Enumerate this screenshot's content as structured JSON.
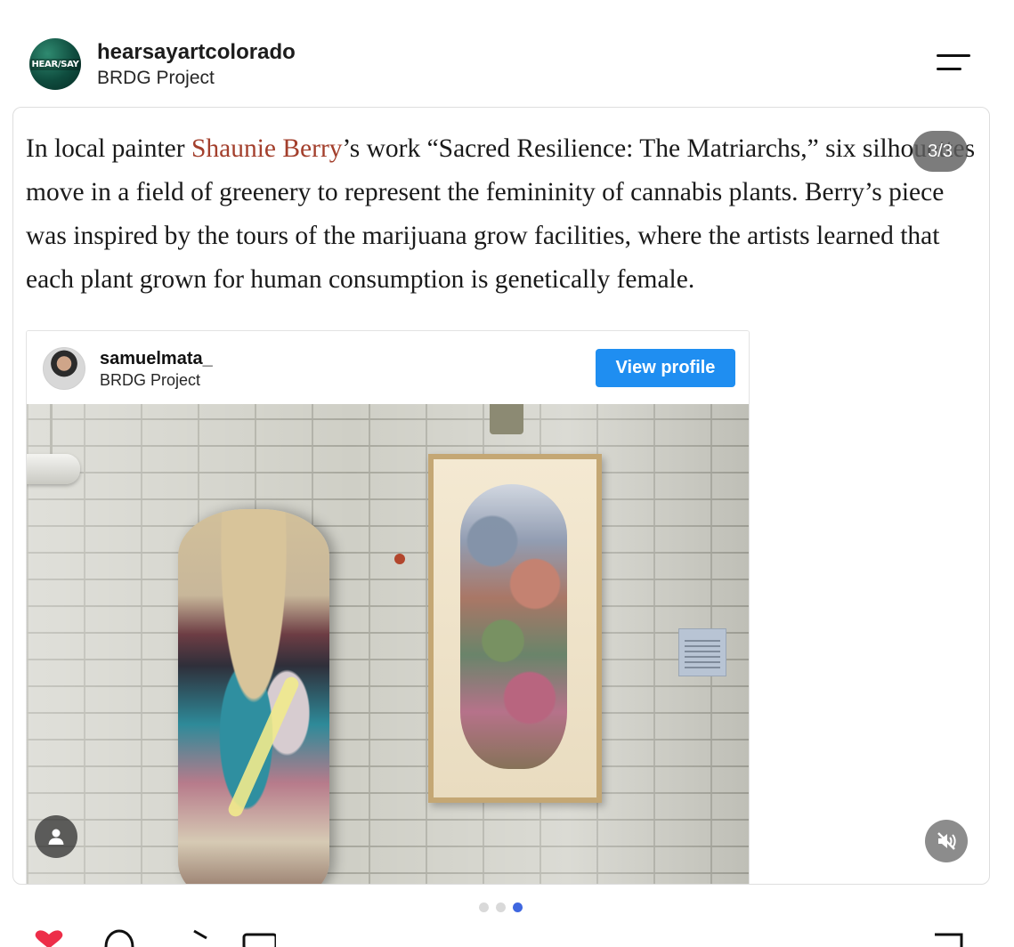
{
  "header": {
    "account_name": "hearsayartcolorado",
    "subtitle": "BRDG Project",
    "avatar_text": "HEAR/SAY"
  },
  "carousel": {
    "counter": "3/3",
    "dots_total": 3,
    "active_dot": 3,
    "text": {
      "part1": "In local painter ",
      "link": "Shaunie Berry",
      "part2": "’s work “Sacred Resilience: The Matriarchs,” six silhouettes move in a field of greenery to represent the femininity of cannabis plants. Berry’s piece was inspired by the tours of the marijuana grow facilities, where the artists learned that each plant grown for human consumption is genetically female."
    },
    "link_color": "#a33f2c"
  },
  "embed": {
    "username": "samuelmata_",
    "subtitle": "BRDG Project",
    "view_profile_label": "View profile",
    "button_color": "#1f8ef1"
  },
  "icons": {
    "menu": "hamburger-menu-icon",
    "person": "person-icon",
    "mute": "speaker-muted-icon",
    "heart": "heart-icon",
    "comment": "comment-icon",
    "share": "share-icon",
    "bookmark": "bookmark-icon"
  }
}
